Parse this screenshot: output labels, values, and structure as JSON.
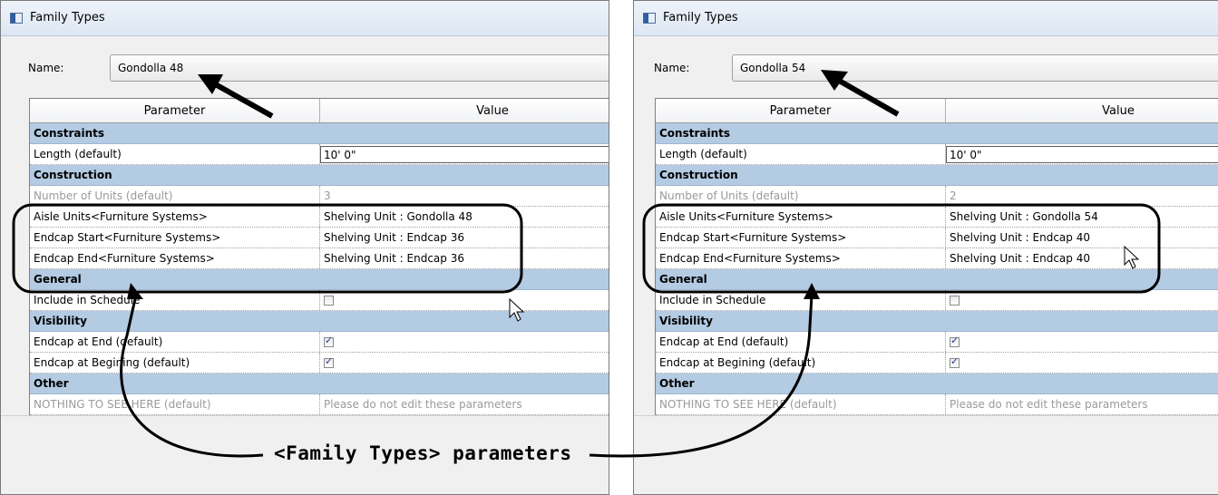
{
  "windows": [
    {
      "title": "Family Types",
      "name_label": "Name:",
      "name_value": "Gondolla 48",
      "columns": {
        "parameter": "Parameter",
        "value": "Value"
      },
      "constraints": {
        "label": "Constraints",
        "length_param": "Length (default)",
        "length_value": "10'  0\""
      },
      "construction": {
        "label": "Construction",
        "num_units_param": "Number of Units (default)",
        "num_units_value": "3",
        "aisle_param": "Aisle Units<Furniture Systems>",
        "aisle_value": "Shelving Unit : Gondolla 48",
        "start_param": "Endcap Start<Furniture Systems>",
        "start_value": "Shelving Unit : Endcap 36",
        "end_param": "Endcap End<Furniture Systems>",
        "end_value": "Shelving Unit : Endcap 36"
      },
      "general": {
        "label": "General",
        "include_param": "Include in Schedule",
        "include_checked": false
      },
      "visibility": {
        "label": "Visibility",
        "end_param": "Endcap at End (default)",
        "end_checked": true,
        "begin_param": "Endcap at Begining (default)",
        "begin_checked": true
      },
      "other": {
        "label": "Other",
        "nothing_param": "NOTHING TO SEE HERE  (default)",
        "nothing_value": "Please do not edit these parameters"
      }
    },
    {
      "title": "Family Types",
      "name_label": "Name:",
      "name_value": "Gondolla 54",
      "columns": {
        "parameter": "Parameter",
        "value": "Value"
      },
      "constraints": {
        "label": "Constraints",
        "length_param": "Length (default)",
        "length_value": "10'  0\""
      },
      "construction": {
        "label": "Construction",
        "num_units_param": "Number of Units (default)",
        "num_units_value": "2",
        "aisle_param": "Aisle Units<Furniture Systems>",
        "aisle_value": "Shelving Unit : Gondolla 54",
        "start_param": "Endcap Start<Furniture Systems>",
        "start_value": "Shelving Unit : Endcap 40",
        "end_param": "Endcap End<Furniture Systems>",
        "end_value": "Shelving Unit : Endcap 40"
      },
      "general": {
        "label": "General",
        "include_param": "Include in Schedule",
        "include_checked": false
      },
      "visibility": {
        "label": "Visibility",
        "end_param": "Endcap at End (default)",
        "end_checked": true,
        "begin_param": "Endcap at Begining (default)",
        "begin_checked": true
      },
      "other": {
        "label": "Other",
        "nothing_param": "NOTHING TO SEE HERE  (default)",
        "nothing_value": "Please do not edit these parameters"
      }
    }
  ],
  "annotation": {
    "callout": "<Family Types> parameters"
  },
  "colors": {
    "group_header": "#b3cbe3",
    "titlebar": "#dde7f3",
    "dialog_bg": "#f0f0f0"
  }
}
